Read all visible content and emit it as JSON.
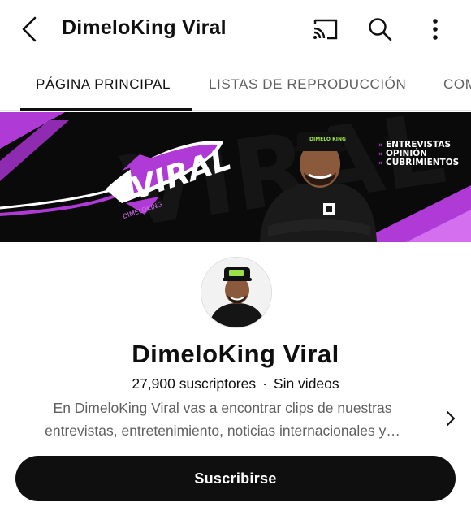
{
  "header": {
    "title": "DimeloKing Viral",
    "icons": [
      "back-icon",
      "cast-icon",
      "search-icon",
      "more-vert-icon"
    ]
  },
  "tabs": [
    {
      "label": "PÁGINA PRINCIPAL",
      "active": true
    },
    {
      "label": "LISTAS DE REPRODUCCIÓN",
      "active": false
    },
    {
      "label": "COM",
      "active": false
    }
  ],
  "banner": {
    "logo_text": "VIRAL",
    "sub_logo_text": "DIMELOKING",
    "bullets": [
      "ENTREVISTAS",
      "OPINIÓN",
      "CUBRIMIENTOS"
    ],
    "cap_text": "DIMELO KING",
    "colors": {
      "accent": "#b03ad6",
      "background": "#0a0a0a"
    }
  },
  "channel": {
    "name": "DimeloKing Viral",
    "subscribers": "27,900 suscriptores",
    "separator": "·",
    "videos": "Sin videos",
    "description": "En DimeloKing Viral vas a encontrar clips de nuestras entrevistas, entretenimiento, noticias internacionales  y…"
  },
  "subscribe": {
    "label": "Suscribirse"
  }
}
